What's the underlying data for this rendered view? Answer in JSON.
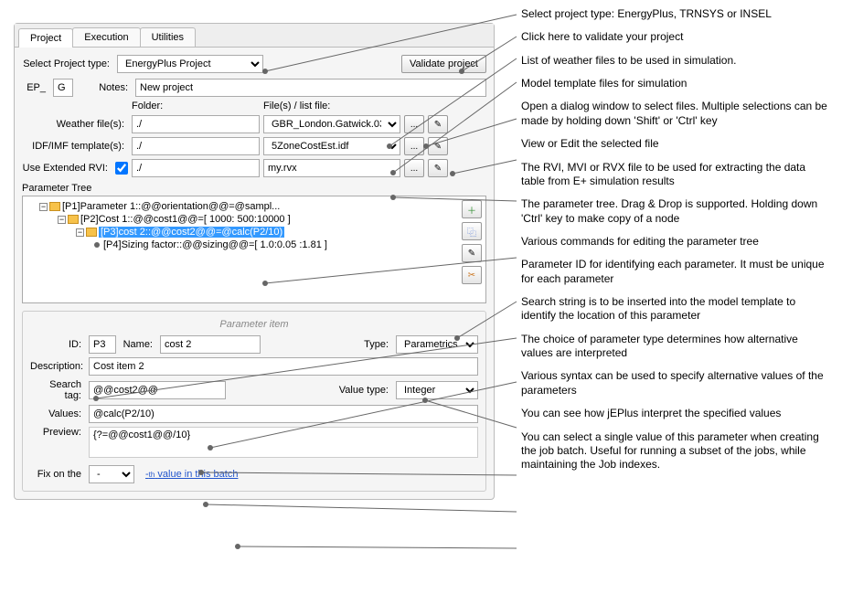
{
  "tabs": {
    "project": "Project",
    "execution": "Execution",
    "utilities": "Utilities"
  },
  "topRow": {
    "selectLabel": "Select Project type:",
    "projectType": "EnergyPlus Project",
    "validateBtn": "Validate project"
  },
  "epRow": {
    "epLabel": "EP_",
    "epValue": "G",
    "notesLabel": "Notes:",
    "notesValue": "New project"
  },
  "headers": {
    "folder": "Folder:",
    "files": "File(s) / list file:"
  },
  "weather": {
    "label": "Weather file(s):",
    "folder": "./",
    "file": "GBR_London.Gatwick.03..."
  },
  "idf": {
    "label": "IDF/IMF template(s):",
    "folder": "./",
    "file": "5ZoneCostEst.idf"
  },
  "rvi": {
    "label": "Use Extended RVI:",
    "folder": "./",
    "file": "my.rvx"
  },
  "ptree": {
    "title": "Parameter Tree",
    "n1": "[P1]Parameter 1::@@orientation@@=@sampl...",
    "n2": "[P2]Cost 1::@@cost1@@=[ 1000: 500:10000 ]",
    "n3": "[P3]cost 2::@@cost2@@=@calc(P2/10)",
    "n4": "[P4]Sizing factor::@@sizing@@=[ 1.0:0.05 :1.81 ]"
  },
  "param": {
    "title": "Parameter item",
    "idLabel": "ID:",
    "id": "P3",
    "nameLabel": "Name:",
    "name": "cost 2",
    "typeLabel": "Type:",
    "type": "Parametrics",
    "descLabel": "Description:",
    "desc": "Cost item 2",
    "tagLabel": "Search tag:",
    "tag": "@@cost2@@",
    "vtypeLabel": "Value type:",
    "vtype": "Integer",
    "valuesLabel": "Values:",
    "values": "@calc(P2/10)",
    "previewLabel": "Preview:",
    "preview": "{?=@@cost1@@/10}",
    "fixLabel": "Fix on the",
    "fixSel": "-",
    "fixSuffix": "value in this batch"
  },
  "annotations": {
    "a1": "Select project type: EnergyPlus, TRNSYS or INSEL",
    "a2": "Click here to validate your project",
    "a3": "List of weather files to be used in simulation.",
    "a4": "Model template files for simulation",
    "a5": "Open a dialog window to select files. Multiple selections can be made by holding down 'Shift' or 'Ctrl' key",
    "a6": "View or Edit the selected file",
    "a7": "The RVI, MVI or RVX file to be used for extracting the data table from E+ simulation results",
    "a8": "The parameter tree. Drag & Drop is supported. Holding down 'Ctrl' key to make copy of a node",
    "a9": "Various commands for editing the parameter tree",
    "a10": "Parameter ID for identifying each parameter. It must be unique for each parameter",
    "a11": "Search string is to be inserted into the model template to identify the location of this parameter",
    "a12": "The choice of parameter type determines how alternative values are interpreted",
    "a13": "Various syntax can be used to specify alternative values of the parameters",
    "a14": "You can see how jEPlus interpret the specified values",
    "a15": "You can select a single value of this parameter when creating the job batch. Useful for running a subset of the jobs, while maintaining the Job indexes."
  }
}
